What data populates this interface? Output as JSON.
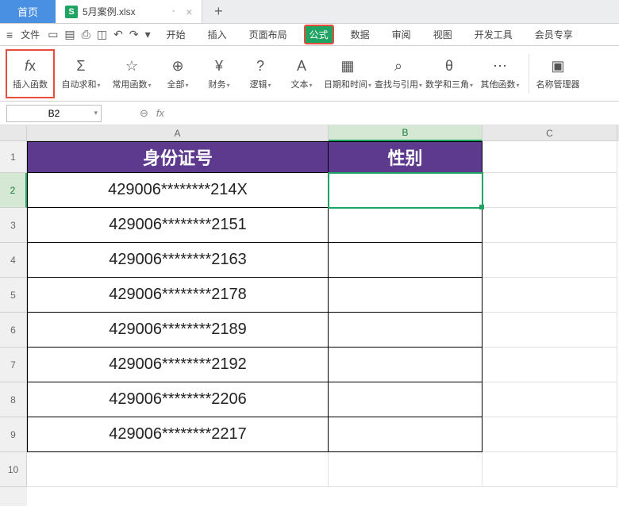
{
  "tabs": {
    "home": "首页",
    "file_name": "5月案例.xlsx",
    "file_icon": "S"
  },
  "menu": {
    "file": "文件",
    "items": [
      "开始",
      "插入",
      "页面布局",
      "公式",
      "数据",
      "审阅",
      "视图",
      "开发工具",
      "会员专享"
    ],
    "active_index": 3
  },
  "ribbon": {
    "insert_fn": "插入函数",
    "autosum": "自动求和",
    "common": "常用函数",
    "all": "全部",
    "finance": "财务",
    "logic": "逻辑",
    "text": "文本",
    "datetime": "日期和时间",
    "lookup": "查找与引用",
    "math": "数学和三角",
    "other": "其他函数",
    "name_mgr": "名称管理器"
  },
  "namebox": {
    "value": "B2",
    "fx": "fx"
  },
  "grid": {
    "cols": [
      "A",
      "B",
      "C"
    ],
    "row_numbers": [
      "1",
      "2",
      "3",
      "4",
      "5",
      "6",
      "7",
      "8",
      "9",
      "10"
    ],
    "selected_cell": "B2",
    "header_row": {
      "A": "身份证号",
      "B": "性别"
    },
    "rows": [
      {
        "A": "429006********214X",
        "B": ""
      },
      {
        "A": "429006********2151",
        "B": ""
      },
      {
        "A": "429006********2163",
        "B": ""
      },
      {
        "A": "429006********2178",
        "B": ""
      },
      {
        "A": "429006********2189",
        "B": ""
      },
      {
        "A": "429006********2192",
        "B": ""
      },
      {
        "A": "429006********2206",
        "B": ""
      },
      {
        "A": "429006********2217",
        "B": ""
      }
    ]
  },
  "chart_data": {
    "type": "table",
    "columns": [
      "身份证号",
      "性别"
    ],
    "rows": [
      [
        "429006********214X",
        ""
      ],
      [
        "429006********2151",
        ""
      ],
      [
        "429006********2163",
        ""
      ],
      [
        "429006********2178",
        ""
      ],
      [
        "429006********2189",
        ""
      ],
      [
        "429006********2192",
        ""
      ],
      [
        "429006********2206",
        ""
      ],
      [
        "429006********2217",
        ""
      ]
    ]
  }
}
